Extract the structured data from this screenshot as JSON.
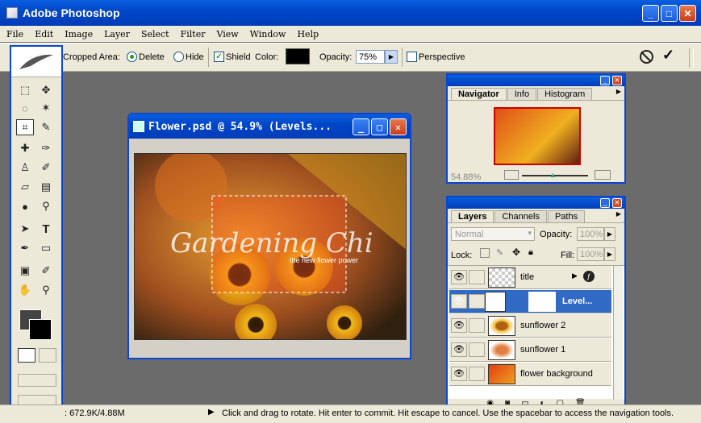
{
  "app": {
    "title": "Adobe Photoshop"
  },
  "menu": [
    "File",
    "Edit",
    "Image",
    "Layer",
    "Select",
    "Filter",
    "View",
    "Window",
    "Help"
  ],
  "options": {
    "cropped_area_label": "Cropped Area:",
    "delete_label": "Delete",
    "hide_label": "Hide",
    "shield_label": "Shield",
    "color_label": "Color:",
    "opacity_label": "Opacity:",
    "opacity_value": "75%",
    "perspective_label": "Perspective"
  },
  "document": {
    "title": "Flower.psd @ 54.9% (Levels...",
    "image_text": "Gardening Chi",
    "image_subtext": "the new flower power"
  },
  "navigator": {
    "tabs": [
      "Navigator",
      "Info",
      "Histogram"
    ],
    "zoom": "54.88%"
  },
  "layers": {
    "tabs": [
      "Layers",
      "Channels",
      "Paths"
    ],
    "blend_mode": "Normal",
    "opacity_label": "Opacity:",
    "opacity_value": "100%",
    "lock_label": "Lock:",
    "fill_label": "Fill:",
    "fill_value": "100%",
    "items": [
      {
        "name": "title"
      },
      {
        "name": "Level..."
      },
      {
        "name": "sunflower 2"
      },
      {
        "name": "sunflower 1"
      },
      {
        "name": "flower background"
      }
    ]
  },
  "status": {
    "doc_size": ": 672.9K/4.88M",
    "message": "Click and drag to rotate. Hit enter to commit. Hit escape to cancel. Use the spacebar to access the navigation tools."
  },
  "colors": {
    "accent": "#0a46d4",
    "selection": "#316ac5"
  }
}
